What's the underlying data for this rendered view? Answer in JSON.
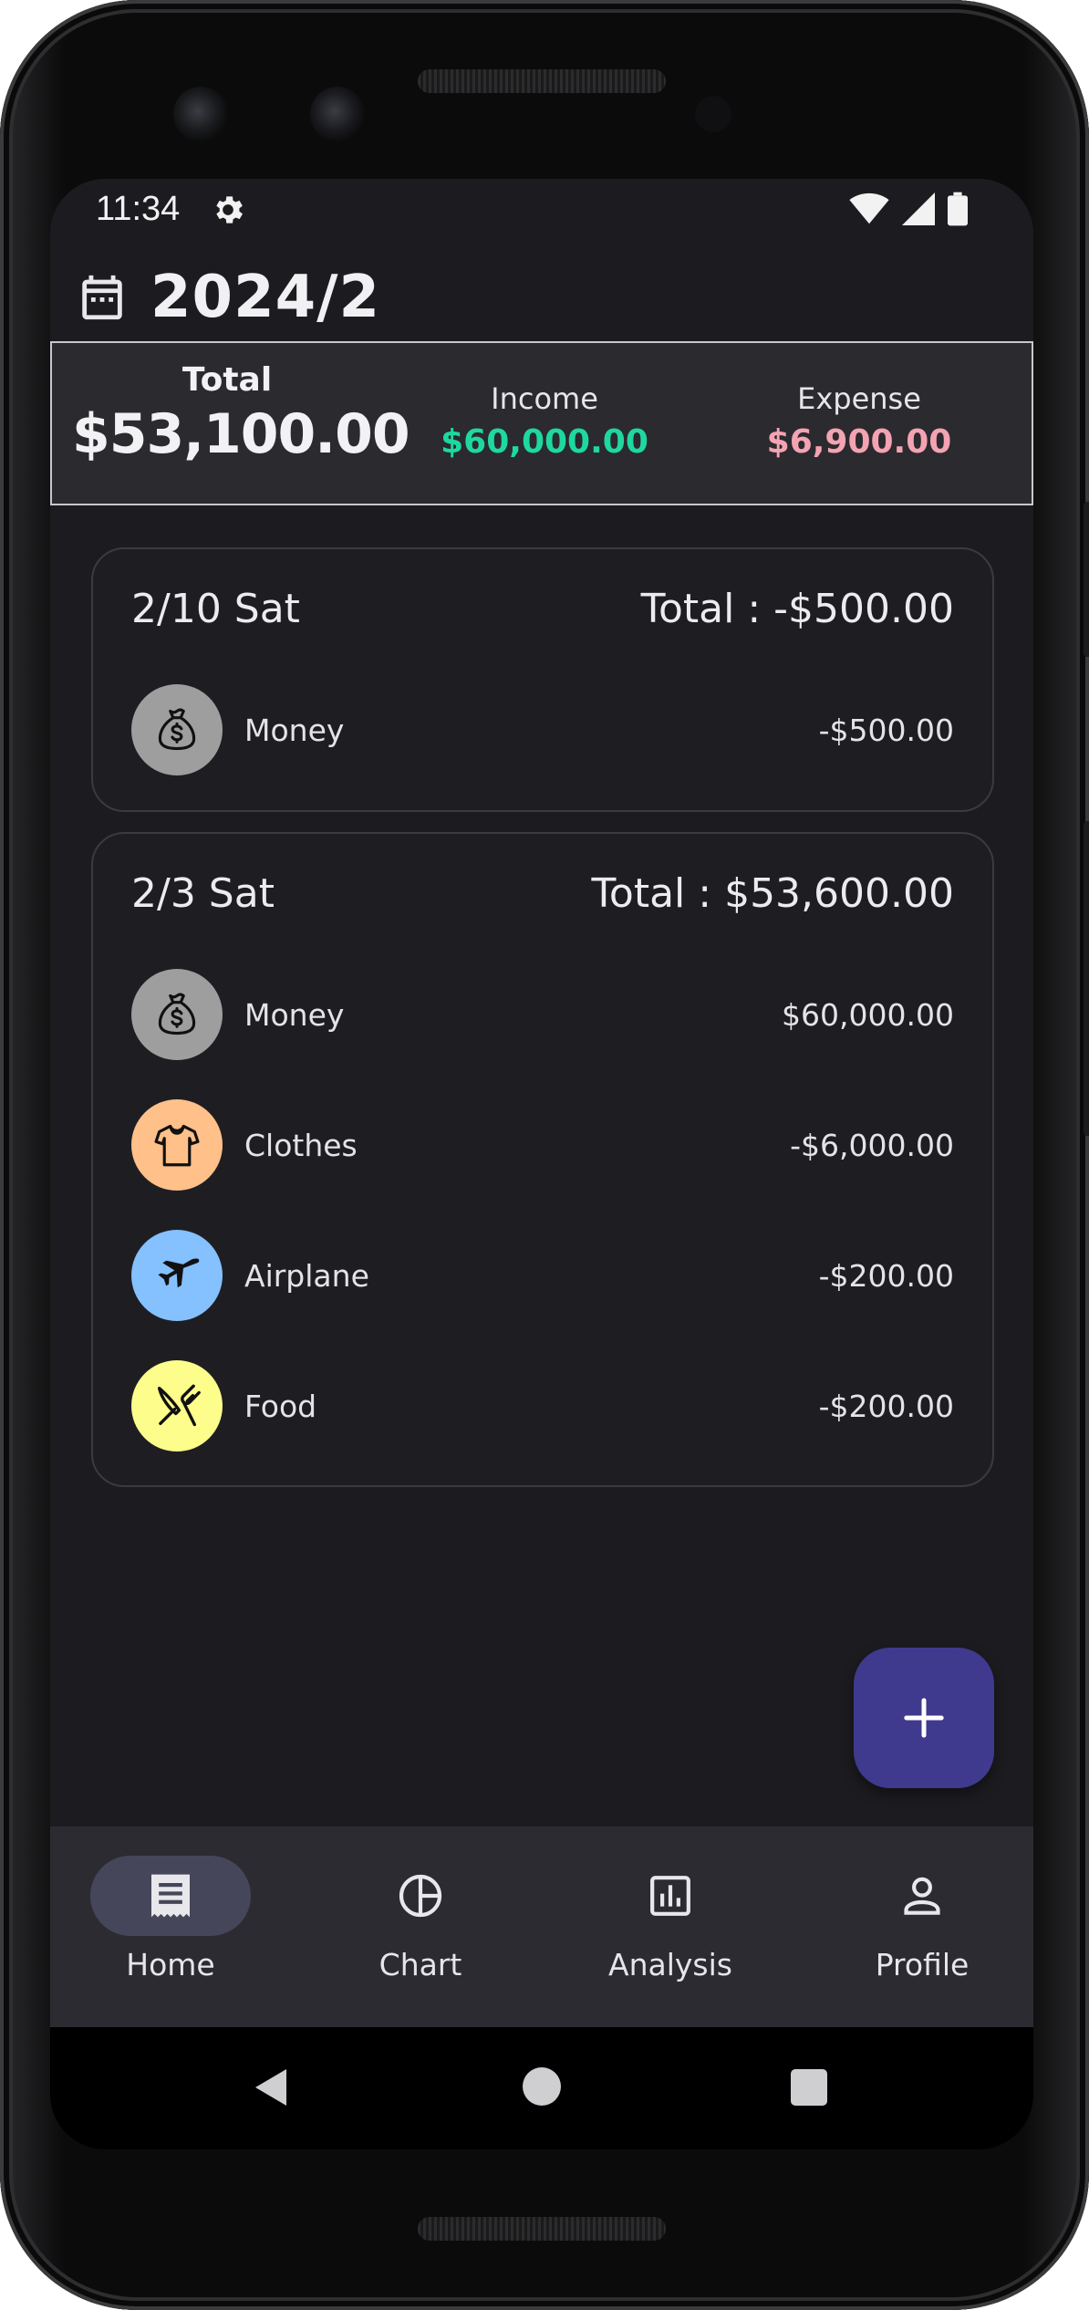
{
  "status": {
    "time": "11:34"
  },
  "header": {
    "month": "2024/2"
  },
  "summary": {
    "total_label": "Total",
    "total_value": "$53,100.00",
    "income_label": "Income",
    "income_value": "$60,000.00",
    "expense_label": "Expense",
    "expense_value": "$6,900.00",
    "colors": {
      "income": "#1ed8a0",
      "expense": "#f4a3b2"
    }
  },
  "days": [
    {
      "date": "2/10 Sat",
      "total": "Total : -$500.00",
      "items": [
        {
          "icon": "money-bag-icon",
          "name": "Money",
          "amount": "-$500.00",
          "color": "#9e9e9e"
        }
      ]
    },
    {
      "date": "2/3 Sat",
      "total": "Total : $53,600.00",
      "items": [
        {
          "icon": "money-bag-icon",
          "name": "Money",
          "amount": "$60,000.00",
          "color": "#9e9e9e"
        },
        {
          "icon": "shirt-icon",
          "name": "Clothes",
          "amount": "-$6,000.00",
          "color": "#ffc08a"
        },
        {
          "icon": "airplane-icon",
          "name": "Airplane",
          "amount": "-$200.00",
          "color": "#85c0ff"
        },
        {
          "icon": "fork-knife-icon",
          "name": "Food",
          "amount": "-$200.00",
          "color": "#fdfd8c"
        }
      ]
    }
  ],
  "fab": {
    "icon": "plus-icon",
    "color": "#3f3a8e"
  },
  "nav": [
    {
      "label": "Home",
      "icon": "receipt-icon",
      "active": true
    },
    {
      "label": "Chart",
      "icon": "pie-chart-icon",
      "active": false
    },
    {
      "label": "Analysis",
      "icon": "bar-chart-icon",
      "active": false
    },
    {
      "label": "Profile",
      "icon": "person-icon",
      "active": false
    }
  ]
}
